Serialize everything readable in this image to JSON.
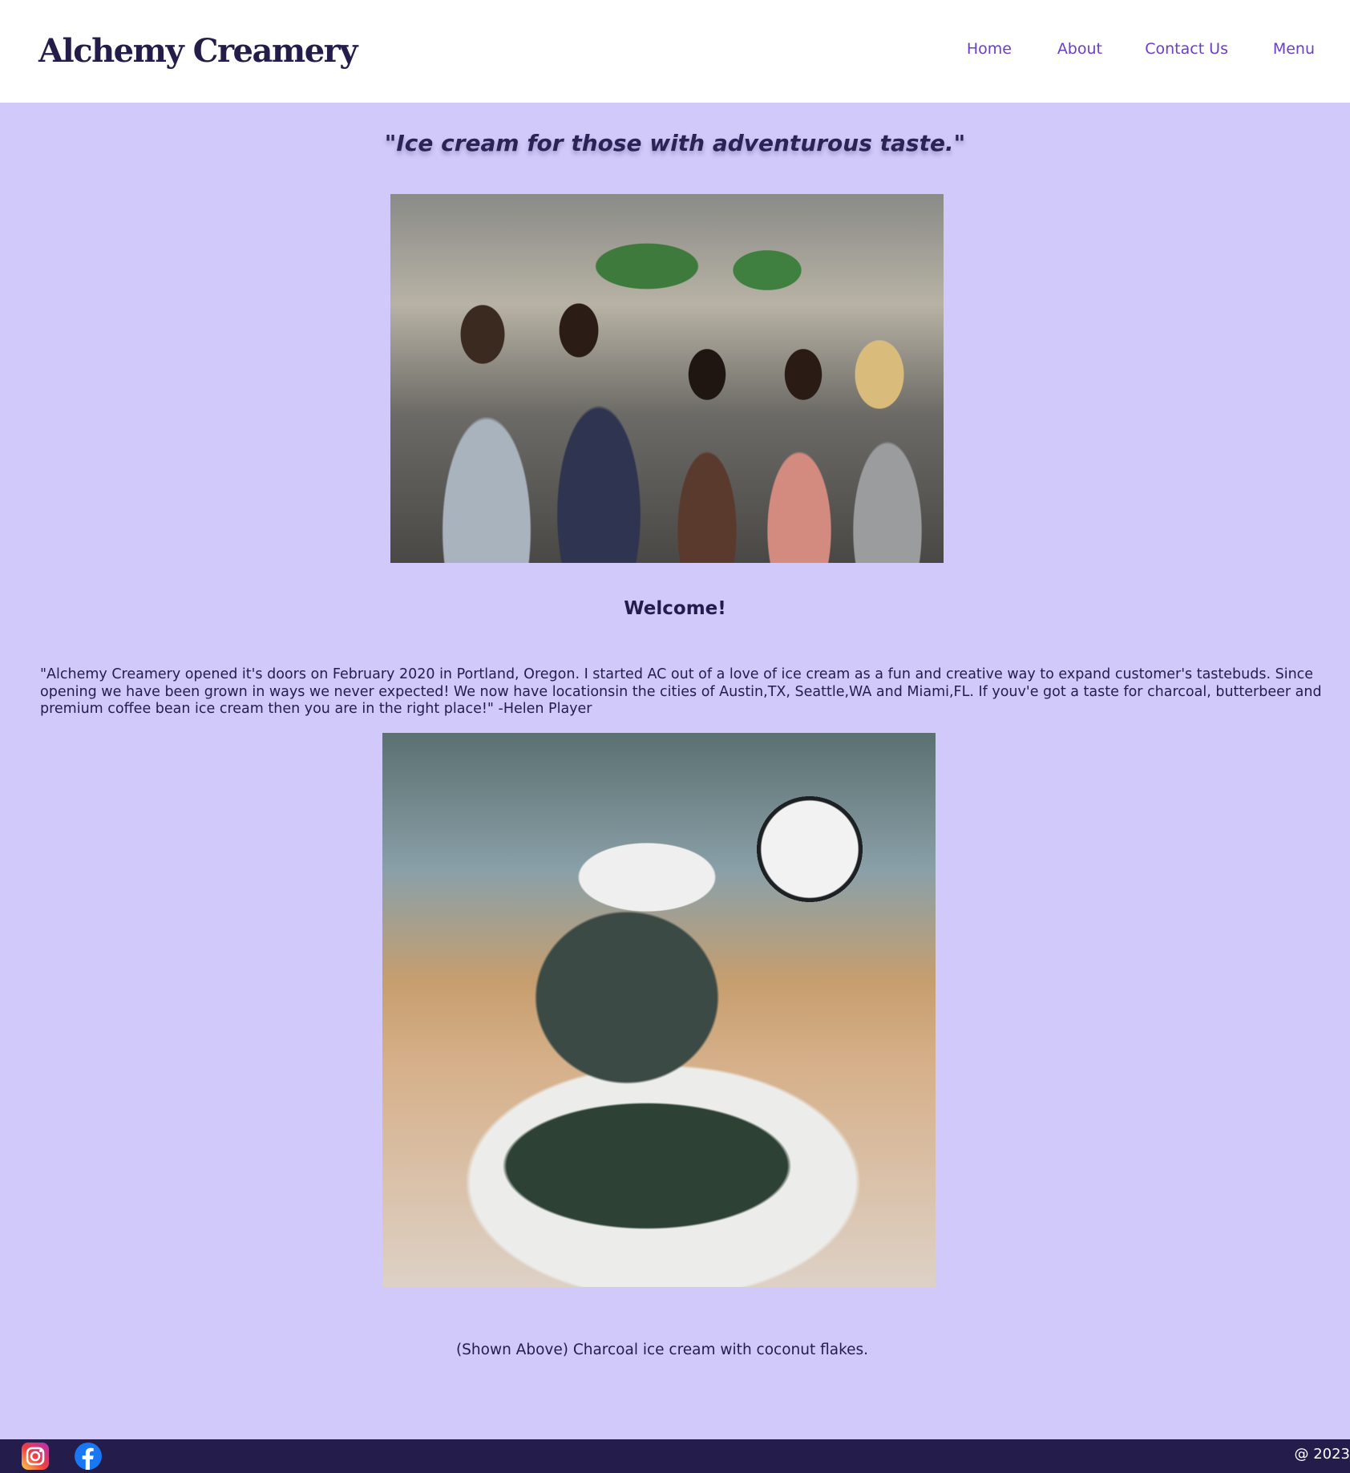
{
  "header": {
    "logo": "Alchemy Creamery",
    "nav": [
      {
        "label": "Home"
      },
      {
        "label": "About"
      },
      {
        "label": "Contact Us"
      },
      {
        "label": "Menu"
      }
    ]
  },
  "main": {
    "tagline": "\"Ice cream for those with adventurous taste.\"",
    "welcome": "Welcome!",
    "story": "\"Alchemy Creamery opened it's doors on February 2020 in Portland, Oregon. I started AC out of a love of ice cream as a fun and creative way to expand customer's tastebuds. Since opening we have been grown in ways we never expected! We now have locationsin the cities of Austin,TX, Seattle,WA and Miami,FL. If youv'e got a taste for charcoal, butterbeer and premium coffee bean ice cream then you are in the right place!\" -Helen Player",
    "caption": "(Shown Above) Charcoal ice cream with coconut flakes."
  },
  "footer": {
    "social": [
      {
        "icon": "instagram-icon"
      },
      {
        "icon": "facebook-icon"
      }
    ],
    "copyright": "@ 2023"
  },
  "colors": {
    "page_background": "#d2c9fb",
    "header_background": "#ffffff",
    "footer_background": "#241c4b",
    "nav_link": "#6a3fc5",
    "text": "#241d4a"
  }
}
